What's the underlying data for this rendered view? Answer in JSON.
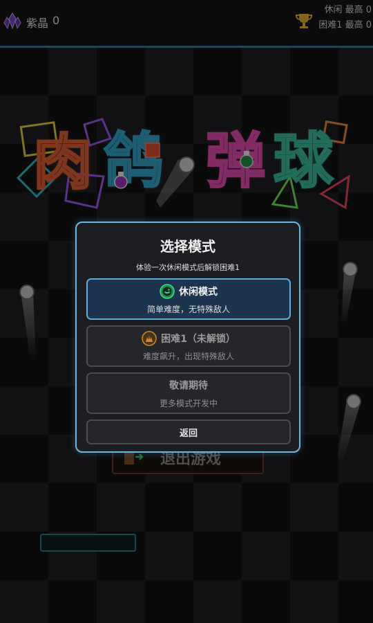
{
  "hud": {
    "crystal_label": "紫晶",
    "crystal_count": "0",
    "score_casual": "休闲 最高 0",
    "score_hard": "困难1 最高 0"
  },
  "title": {
    "chars": [
      "肉",
      "鸽",
      "弹",
      "球"
    ]
  },
  "background": {
    "exit_button_label": "退出游戏"
  },
  "dialog": {
    "title": "选择模式",
    "subtitle": "体验一次休闲模式后解锁困难1",
    "options": [
      {
        "label": "休闲模式",
        "desc": "简单难度，无特殊敌人",
        "icon": "smile-icon",
        "locked": false
      },
      {
        "label": "困难1（未解锁）",
        "desc": "难度飙升，出现特殊敌人",
        "icon": "fire-icon",
        "locked": true
      },
      {
        "label": "敬请期待",
        "desc": "更多模式开发中",
        "icon": "",
        "locked": true
      }
    ],
    "back_label": "返回"
  },
  "colors": {
    "accent": "#6cb8e4",
    "selected_bg": "#1c3450",
    "smile": "#3ddc84",
    "fire": "#d08a2c"
  }
}
